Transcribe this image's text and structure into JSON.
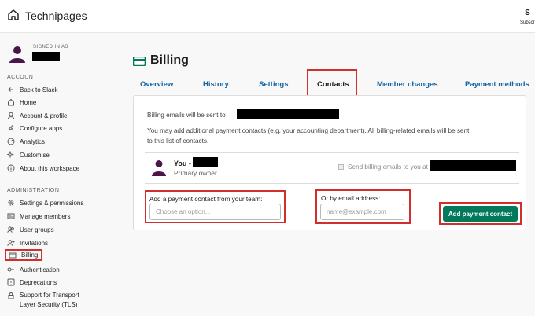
{
  "topbar": {
    "site_name": "Technipages",
    "subscribe_label": "Subscribe",
    "subscribe_icon": "S"
  },
  "sidebar": {
    "signed_in_label": "SIGNED IN AS",
    "account_heading": "ACCOUNT",
    "account_items": [
      {
        "label": "Back to Slack",
        "icon": "arrow-left-icon"
      },
      {
        "label": "Home",
        "icon": "home-icon"
      },
      {
        "label": "Account & profile",
        "icon": "user-icon"
      },
      {
        "label": "Configure apps",
        "icon": "plug-icon"
      },
      {
        "label": "Analytics",
        "icon": "gauge-icon"
      },
      {
        "label": "Customise",
        "icon": "sparkle-icon"
      },
      {
        "label": "About this workspace",
        "icon": "info-icon"
      }
    ],
    "admin_heading": "ADMINISTRATION",
    "admin_items": [
      {
        "label": "Settings & permissions",
        "icon": "gear-icon"
      },
      {
        "label": "Manage members",
        "icon": "id-card-icon"
      },
      {
        "label": "User groups",
        "icon": "users-icon"
      },
      {
        "label": "Invitations",
        "icon": "add-user-icon"
      },
      {
        "label": "Billing",
        "icon": "credit-card-icon"
      },
      {
        "label": "Authentication",
        "icon": "key-icon"
      },
      {
        "label": "Deprecations",
        "icon": "warning-icon"
      },
      {
        "label": "Support for Transport",
        "label2": "Layer Security (TLS)",
        "icon": "lock-icon"
      }
    ]
  },
  "main": {
    "title": "Billing",
    "tabs": [
      "Overview",
      "History",
      "Settings",
      "Contacts",
      "Member changes",
      "Payment methods"
    ],
    "active_tab": "Contacts",
    "billing_emails_text": "Billing emails will be sent to",
    "info_line1": "You may add additional payment contacts (e.g. your accounting department). All billing-related emails will be sent",
    "info_line2": "to this list of contacts.",
    "owner": {
      "name": "You •",
      "role": "Primary owner",
      "checkbox_label": "Send billing emails to you at"
    },
    "team_label": "Add a payment contact from your team:",
    "team_placeholder": "Choose an option...",
    "email_label": "Or by email address:",
    "email_placeholder": "name@example.com",
    "add_button": "Add payment contact"
  },
  "colors": {
    "highlight": "#d12e2e",
    "link": "#1264a3",
    "button": "#007a5a",
    "avatar": "#4a154b"
  }
}
